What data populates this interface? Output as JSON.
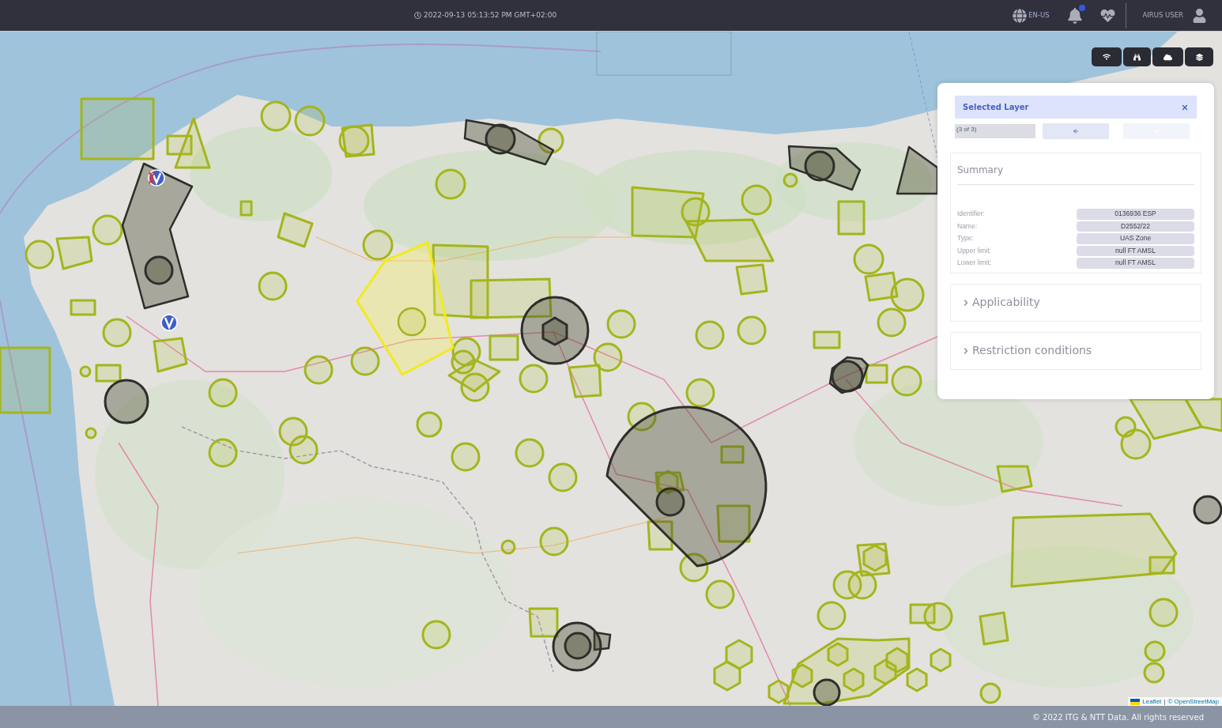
{
  "top_bar": {
    "timestamp": "2022-09-13 05:13:52 PM GMT+02:00",
    "language": "EN-US",
    "notifications": {
      "unread": true
    },
    "user": "AIRUS USER"
  },
  "map": {
    "attribution": {
      "library": "Leaflet",
      "separator": "|",
      "source": "© OpenStreetMap"
    }
  },
  "selected_layer": {
    "title": "Selected Layer",
    "pager": "(3 of 3)",
    "previous": {
      "disabled": false
    },
    "next": {
      "disabled": true
    },
    "summary": {
      "title": "Summary",
      "fields": [
        {
          "label": "Identifier:",
          "value": "0136936 ESP"
        },
        {
          "label": "Name:",
          "value": "D2552/22"
        },
        {
          "label": "Type:",
          "value": "UAS Zone"
        },
        {
          "label": "Upper limit:",
          "value": "null FT AMSL"
        },
        {
          "label": "Lower limit:",
          "value": "null FT AMSL"
        }
      ]
    },
    "sections": [
      {
        "title": "Applicability",
        "expanded": false
      },
      {
        "title": "Restriction conditions",
        "expanded": false
      }
    ]
  },
  "footer": {
    "copyright": "© 2022 ITG & NTT Data. All rights reserved"
  }
}
